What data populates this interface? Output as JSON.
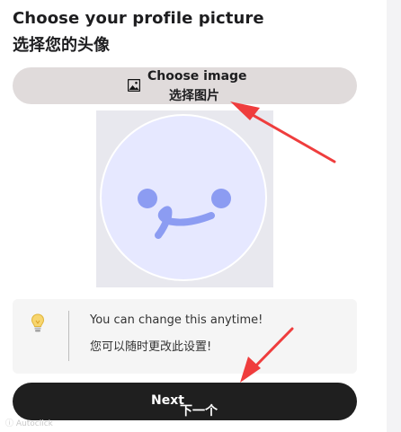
{
  "header": {
    "title_en": "Choose your profile picture",
    "title_zh": "选择您的头像"
  },
  "choose_image": {
    "label_en": "Choose image",
    "label_zh": "选择图片",
    "icon": "image-icon"
  },
  "avatar": {
    "description_icon": "smiley-face-icon",
    "face_color": "#e6e8ff",
    "feature_color": "#8c9cf2"
  },
  "tip": {
    "icon": "lightbulb-icon",
    "text_en": "You can change this anytime!",
    "text_zh": "您可以随时更改此设置!"
  },
  "next_button": {
    "label_en": "Next",
    "label_zh": "下一个"
  },
  "watermark": {
    "text": "ⓘ Autoclick"
  },
  "colors": {
    "arrow": "#ef3d3d",
    "button_dark": "#1f1f1f",
    "button_light": "#e0dbdb"
  }
}
